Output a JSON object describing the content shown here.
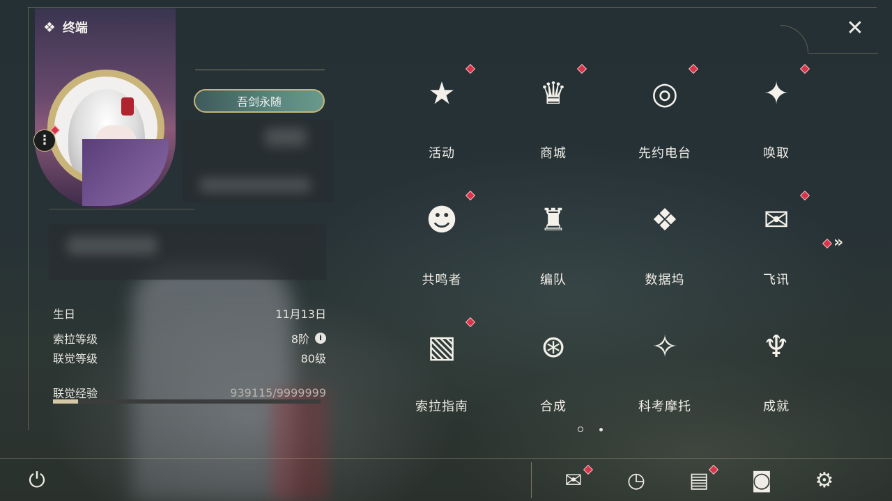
{
  "header": {
    "title": "终端",
    "terminal_icon": "diamond-cluster-icon",
    "close_icon": "close-star-icon"
  },
  "profile": {
    "name": "吾剑永随",
    "menu_label": "⋮",
    "info": [
      {
        "label": "生日",
        "value": "11月13日"
      },
      {
        "label": "索拉等级",
        "value": "8阶"
      },
      {
        "label": "联觉等级",
        "value": "80级"
      }
    ],
    "exp": {
      "label": "联觉经验",
      "value": "939115/9999999",
      "fill_fraction": 0.094
    }
  },
  "menu_grid": [
    {
      "label": "活动",
      "icon": "event-2hd-icon",
      "glyph": "★",
      "badge": true
    },
    {
      "label": "商城",
      "icon": "shop-cart-icon",
      "glyph": "♛",
      "badge": true
    },
    {
      "label": "先约电台",
      "icon": "radio-disc-icon",
      "glyph": "◎",
      "badge": true
    },
    {
      "label": "唤取",
      "icon": "compass-star-icon",
      "glyph": "✦",
      "badge": true
    },
    {
      "label": "共鸣者",
      "icon": "resonator-head-icon",
      "glyph": "☻",
      "badge": true
    },
    {
      "label": "编队",
      "icon": "chess-team-icon",
      "glyph": "♜",
      "badge": false
    },
    {
      "label": "数据坞",
      "icon": "data-dock-icon",
      "glyph": "❖",
      "badge": false
    },
    {
      "label": "飞讯",
      "icon": "message-bubble-icon",
      "glyph": "✉",
      "badge": true
    },
    {
      "label": "索拉指南",
      "icon": "guide-book-icon",
      "glyph": "▧",
      "badge": true
    },
    {
      "label": "合成",
      "icon": "synthesis-orbit-icon",
      "glyph": "⊛",
      "badge": false
    },
    {
      "label": "科考摩托",
      "icon": "motorcycle-icon",
      "glyph": "✧",
      "badge": false
    },
    {
      "label": "成就",
      "icon": "trophy-icon",
      "glyph": "♆",
      "badge": false
    }
  ],
  "pagination": {
    "current": 1,
    "total": 2
  },
  "next_page_glyph": "»",
  "bottom_bar": {
    "power": {
      "icon": "power-icon",
      "glyph": "⏻"
    },
    "mail": {
      "icon": "mail-icon",
      "glyph": "✉",
      "badge": true
    },
    "clock": {
      "icon": "clock-icon",
      "glyph": "◷",
      "badge": false
    },
    "notes": {
      "icon": "notice-doc-icon",
      "glyph": "▤",
      "badge": true
    },
    "camera": {
      "icon": "camera-icon",
      "glyph": "◙",
      "badge": false
    },
    "settings": {
      "icon": "gear-icon",
      "glyph": "⚙",
      "badge": false
    }
  },
  "colors": {
    "accent_gold": "#c9b47a",
    "badge_red": "#d8344a",
    "text": "#f0ede6"
  }
}
